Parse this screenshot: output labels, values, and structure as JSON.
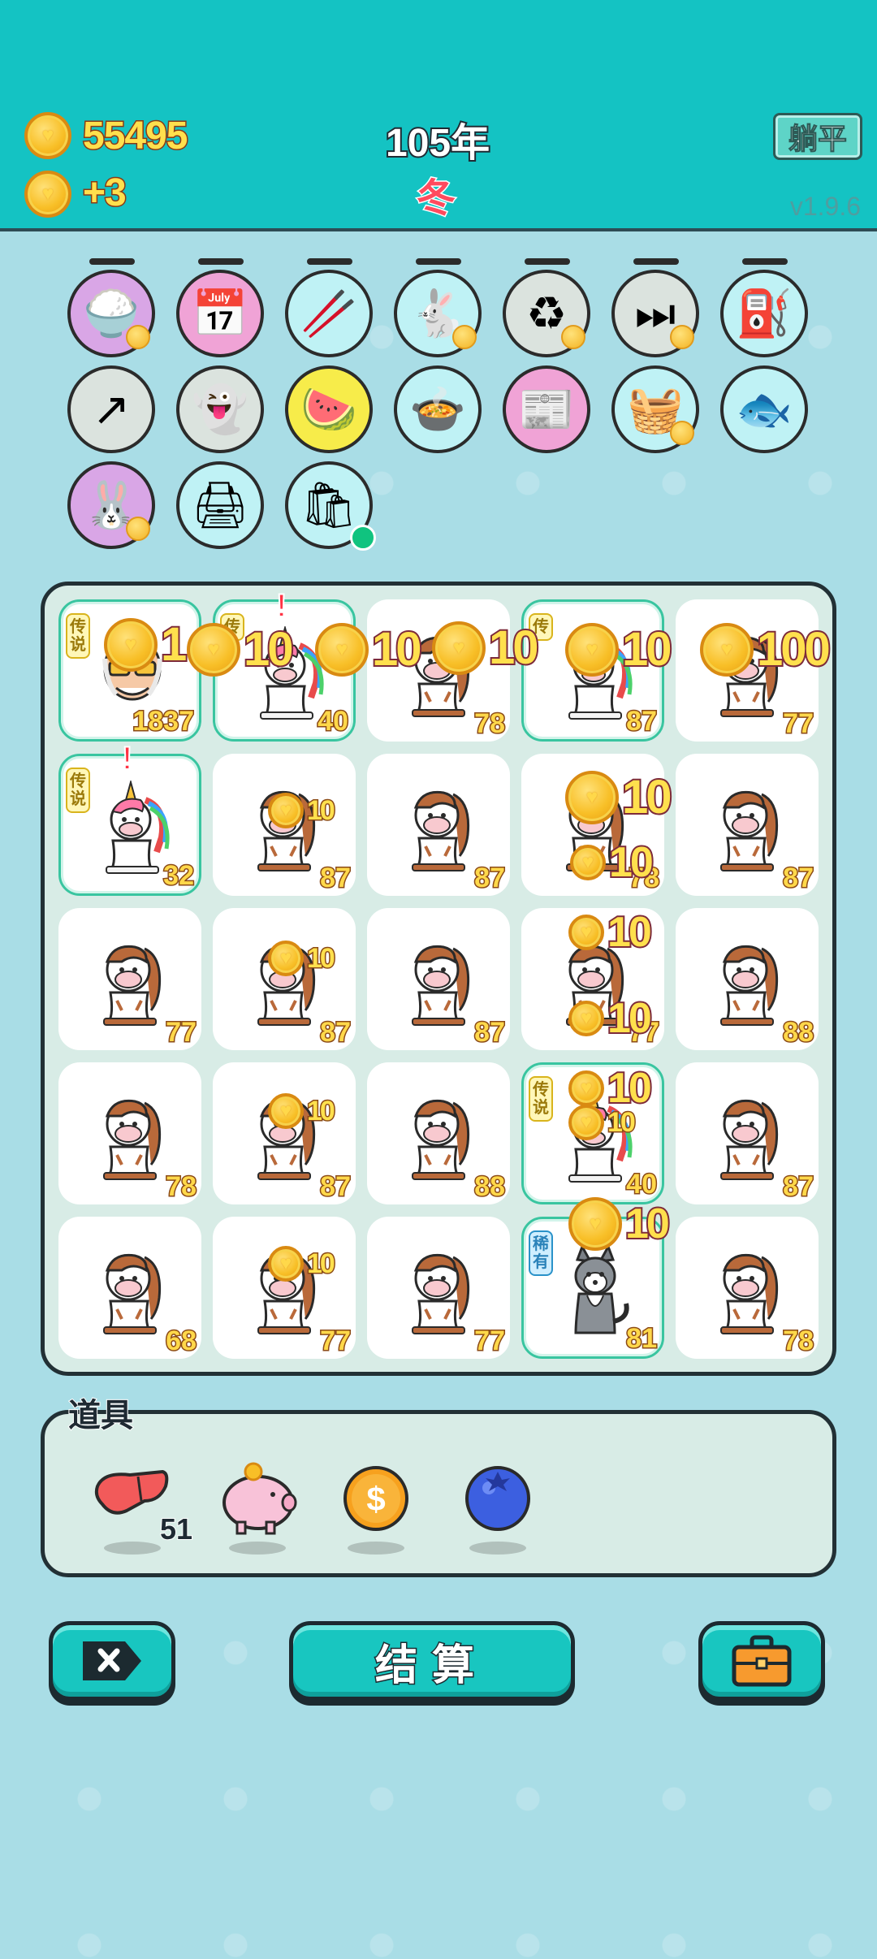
{
  "header": {
    "gold": "55495",
    "income": "+3",
    "year": "105年",
    "season": "冬",
    "flat_button": "躺平",
    "version": "v1.9.6"
  },
  "relics": [
    {
      "name": "rice-bowl",
      "bg": "#d9a6e6",
      "glyph": "🍚"
    },
    {
      "name": "calendar",
      "bg": "#f0a3d6",
      "glyph": "📅"
    },
    {
      "name": "chopsticks",
      "bg": "#bff2f5",
      "glyph": "🥢"
    },
    {
      "name": "rabbit",
      "bg": "#bff2f5",
      "glyph": "🐇"
    },
    {
      "name": "recycle",
      "bg": "#dbe3de",
      "glyph": "♻"
    },
    {
      "name": "skip",
      "bg": "#dbe3de",
      "glyph": "⏭"
    },
    {
      "name": "pump",
      "bg": "#bff2f5",
      "glyph": "⛽"
    },
    {
      "name": "arrow-card",
      "bg": "#dbe3de",
      "glyph": "↗"
    },
    {
      "name": "ghost",
      "bg": "#dbe3de",
      "glyph": "👻"
    },
    {
      "name": "fruit-plate",
      "bg": "#f7ec4a",
      "glyph": "🍉"
    },
    {
      "name": "pot",
      "bg": "#bff2f5",
      "glyph": "🍲"
    },
    {
      "name": "time-magazine",
      "bg": "#f0a3d6",
      "glyph": "📰"
    },
    {
      "name": "fruit-basket",
      "bg": "#bff2f5",
      "glyph": "🧺"
    },
    {
      "name": "fish-tank",
      "bg": "#bff2f5",
      "glyph": "🐟"
    },
    {
      "name": "rabbit-pink",
      "bg": "#d9a6e6",
      "glyph": "🐰"
    },
    {
      "name": "printer",
      "bg": "#bff2f5",
      "glyph": "🖨"
    },
    {
      "name": "bag",
      "bg": "#bff2f5",
      "glyph": "🛍"
    }
  ],
  "board": [
    {
      "animal": "old-man",
      "value": "1837",
      "tag": "传说",
      "tag_type": "legend"
    },
    {
      "animal": "unicorn",
      "value": "40",
      "tag": "传",
      "tag_type": "legend"
    },
    {
      "animal": "cow",
      "value": "78",
      "tag": "",
      "tag_type": ""
    },
    {
      "animal": "unicorn",
      "value": "87",
      "tag": "传",
      "tag_type": "legend"
    },
    {
      "animal": "cow",
      "value": "77",
      "tag": "",
      "tag_type": ""
    },
    {
      "animal": "unicorn",
      "value": "32",
      "tag": "传说",
      "tag_type": "legend"
    },
    {
      "animal": "cow",
      "value": "87",
      "tag": "",
      "tag_type": ""
    },
    {
      "animal": "cow",
      "value": "87",
      "tag": "",
      "tag_type": ""
    },
    {
      "animal": "cow",
      "value": "78",
      "tag": "",
      "tag_type": ""
    },
    {
      "animal": "cow",
      "value": "87",
      "tag": "",
      "tag_type": ""
    },
    {
      "animal": "cow",
      "value": "77",
      "tag": "",
      "tag_type": ""
    },
    {
      "animal": "cow",
      "value": "87",
      "tag": "",
      "tag_type": ""
    },
    {
      "animal": "cow",
      "value": "87",
      "tag": "",
      "tag_type": ""
    },
    {
      "animal": "cow",
      "value": "77",
      "tag": "",
      "tag_type": ""
    },
    {
      "animal": "cow",
      "value": "88",
      "tag": "",
      "tag_type": ""
    },
    {
      "animal": "cow",
      "value": "78",
      "tag": "",
      "tag_type": ""
    },
    {
      "animal": "cow",
      "value": "87",
      "tag": "",
      "tag_type": ""
    },
    {
      "animal": "cow",
      "value": "88",
      "tag": "",
      "tag_type": ""
    },
    {
      "animal": "unicorn",
      "value": "40",
      "tag": "传说",
      "tag_type": "legend"
    },
    {
      "animal": "cow",
      "value": "87",
      "tag": "",
      "tag_type": ""
    },
    {
      "animal": "cow",
      "value": "68",
      "tag": "",
      "tag_type": ""
    },
    {
      "animal": "cow",
      "value": "77",
      "tag": "",
      "tag_type": ""
    },
    {
      "animal": "cow",
      "value": "77",
      "tag": "",
      "tag_type": ""
    },
    {
      "animal": "husky",
      "value": "81",
      "tag": "稀有",
      "tag_type": "rare"
    },
    {
      "animal": "cow",
      "value": "78",
      "tag": "",
      "tag_type": ""
    }
  ],
  "popups": {
    "big": "10",
    "row0_a": "1",
    "row0_b": "10",
    "row0_c": "10",
    "row0_d": "10",
    "row0_e": "10",
    "row0_f": "100",
    "small": "10",
    "tiny": "10"
  },
  "items": {
    "title": "道具",
    "liver_count": "51"
  },
  "buttons": {
    "settle": "结算"
  }
}
